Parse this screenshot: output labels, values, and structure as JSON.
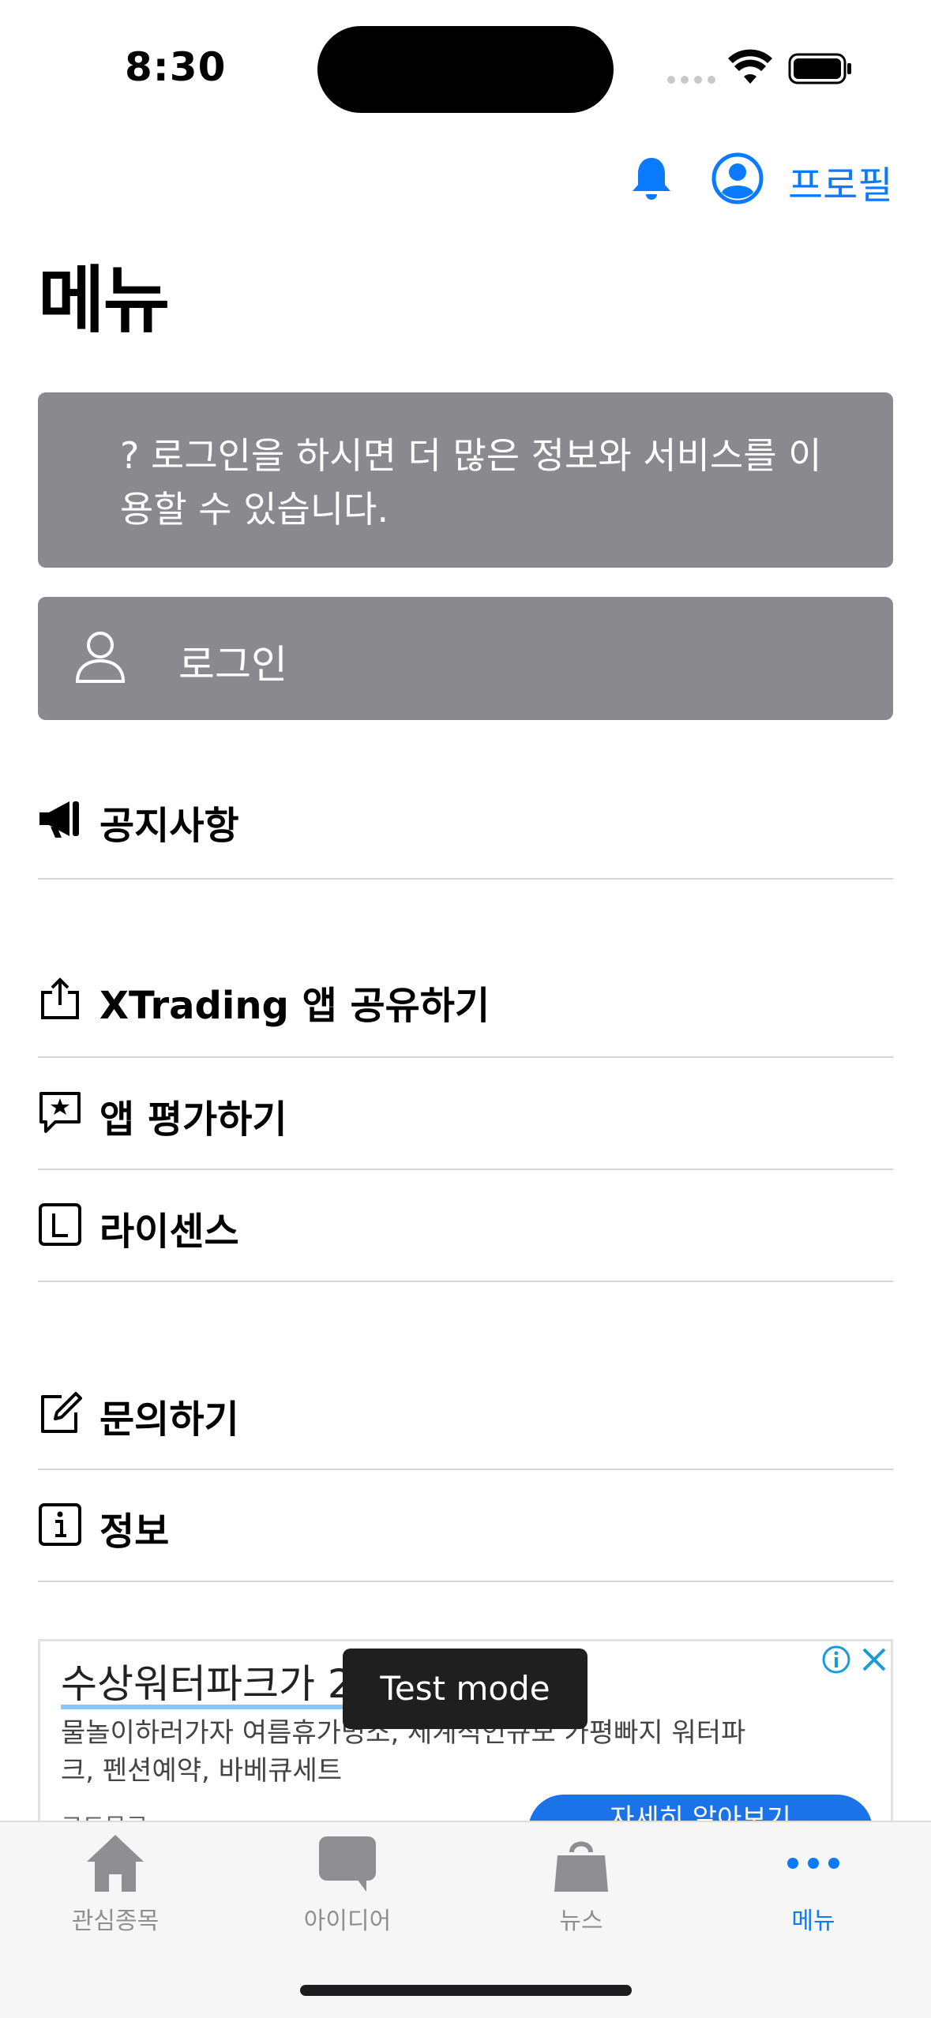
{
  "status_bar": {
    "time": "8:30"
  },
  "header": {
    "profile_label": "프로필"
  },
  "page": {
    "title": "메뉴"
  },
  "login_notice": {
    "text": "? 로그인을 하시면 더 많은 정보와 서비스를 이용할 수 있습니다."
  },
  "login_button": {
    "label": "로그인"
  },
  "menu": {
    "notice": "공지사항",
    "share": "XTrading 앱 공유하기",
    "rate": "앱 평가하기",
    "license": "라이센스",
    "inquiry": "문의하기",
    "info": "정보"
  },
  "ad": {
    "title": "수상워터파크가 2",
    "description": "물놀이하러가자 여름휴가명소, 세계적인규모 가평빠지 워터파크, 펜션예약, 바베큐세트",
    "more": "코드무료",
    "cta": "자세히 알아보기"
  },
  "toast": {
    "text": "Test mode"
  },
  "tabs": [
    {
      "label": "관심종목",
      "icon": "house-icon"
    },
    {
      "label": "아이디어",
      "icon": "speech-bubble-icon"
    },
    {
      "label": "뉴스",
      "icon": "bag-icon"
    },
    {
      "label": "메뉴",
      "icon": "ellipsis-icon"
    }
  ],
  "colors": {
    "accent": "#0a7aff",
    "button_gray": "#8a8a8e",
    "tab_inactive": "#8e8e93"
  }
}
